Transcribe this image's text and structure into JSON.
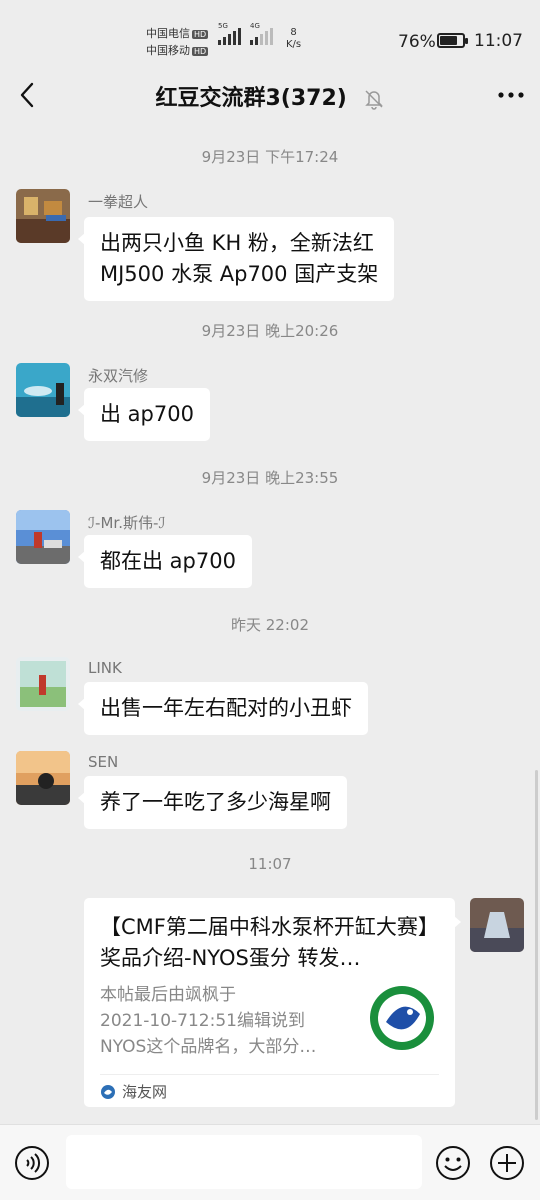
{
  "status_bar": {
    "carrier1": "中国电信",
    "carrier2": "中国移动",
    "hd": "HD",
    "net1": "5G",
    "net2": "4G",
    "speed_value": "8",
    "speed_unit": "K/s",
    "battery": "76%",
    "battery_level": 0.76,
    "time": "11:07"
  },
  "header": {
    "title": "红豆交流群3(372)",
    "back_icon": "chevron-left-icon",
    "mute_icon": "bell-off-icon",
    "more_icon": "more-horizontal-icon"
  },
  "messages": [
    {
      "timestamp": "9月23日 下午17:24",
      "sender": "一拳超人",
      "text": "出两只小鱼 KH 粉，全新法红\nMJ500 水泵 Ap700 国产支架"
    },
    {
      "timestamp": "9月23日 晚上20:26",
      "sender": "永双汽修",
      "text": "出 ap700"
    },
    {
      "timestamp": "9月23日 晚上23:55",
      "sender": "ℐ-Mr.斯伟-ℐ",
      "text": "都在出 ap700"
    },
    {
      "timestamp": "昨天 22:02",
      "sender": "LINK",
      "text": "出售一年左右配对的小丑虾"
    },
    {
      "timestamp": "",
      "sender": "SEN",
      "text": "养了一年吃了多少海星啊"
    }
  ],
  "last_timestamp": "11:07",
  "link_card": {
    "title": "【CMF第二届中科水泵杯开缸大赛】奖品介绍-NYOS蛋分 转发…",
    "description": "本帖最后由飒枫于\n2021-10-712:51编辑说到\nNYOS这个品牌名，大部分…",
    "source": "海友网"
  },
  "input_bar": {
    "placeholder": "",
    "voice_icon": "voice-icon",
    "emoji_icon": "smiley-icon",
    "plus_icon": "plus-circle-icon"
  },
  "colors": {
    "background": "#ededed",
    "bubble": "#ffffff",
    "timestamp": "#888888"
  }
}
